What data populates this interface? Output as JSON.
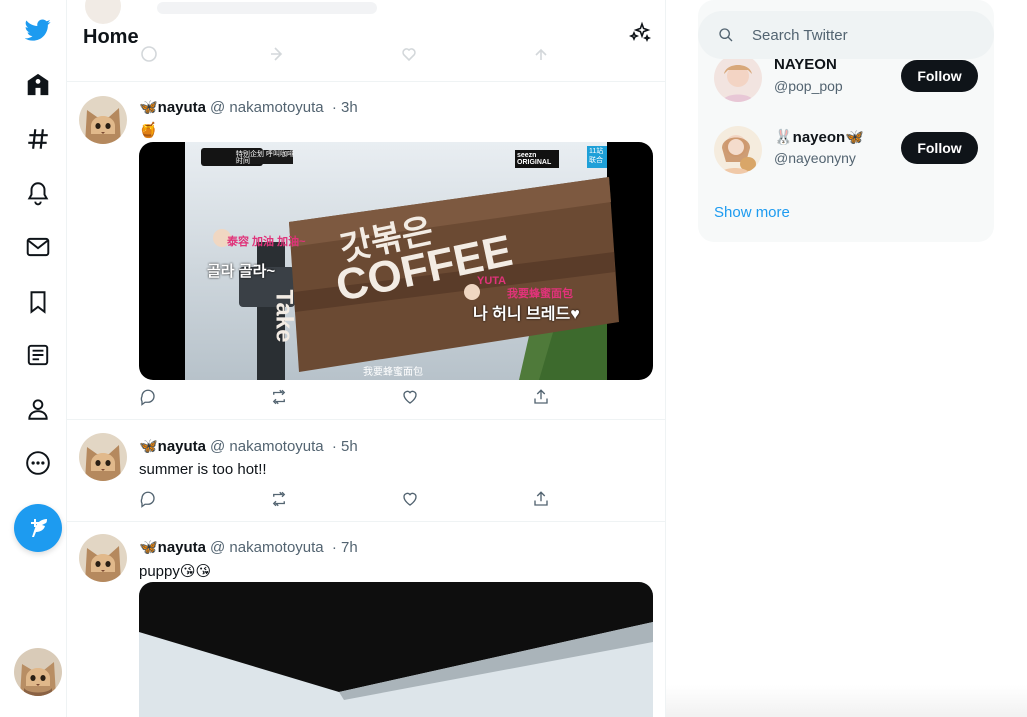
{
  "header": {
    "title": "Home"
  },
  "search": {
    "placeholder": "Search Twitter"
  },
  "tweets": [
    {
      "name": "🦋nayuta",
      "handle": "@ nakamotoyuta",
      "time": "· 3h",
      "text": "🍯"
    },
    {
      "name": "🦋nayuta",
      "handle": "@ nakamotoyuta",
      "time": "· 5h",
      "text": "summer is too hot!!"
    },
    {
      "name": "🦋nayuta",
      "handle": "@ nakamotoyuta",
      "time": "· 7h",
      "text": "puppy😘😘"
    }
  ],
  "video": {
    "top_left_badge": "特别企划 呼叫咖啡时间",
    "top_right_badge": "seezn ORIGINAL",
    "corner_tag": "11站 联合",
    "left_cn": "泰容 加油 加油~",
    "left_kr": "골라 골라~",
    "sign_kr": "갓볶은",
    "sign_coffee": "COFFEE",
    "sign_take": "Take",
    "yuta_label": "YUTA",
    "yuta_cn": "我要蜂蜜面包",
    "yuta_kr": "나 허니 브레드♥",
    "subtitle": "我要蜂蜜面包"
  },
  "who_to_follow": {
    "items": [
      {
        "name": "NAYEON",
        "handle": "@pop_pop",
        "button": "Follow"
      },
      {
        "name": "🐰nayeon🦋",
        "handle": "@nayeonyny",
        "button": "Follow"
      }
    ],
    "show_more": "Show more"
  },
  "colors": {
    "accent": "#1d9bf0",
    "text": "#0f1419",
    "muted": "#536471"
  }
}
